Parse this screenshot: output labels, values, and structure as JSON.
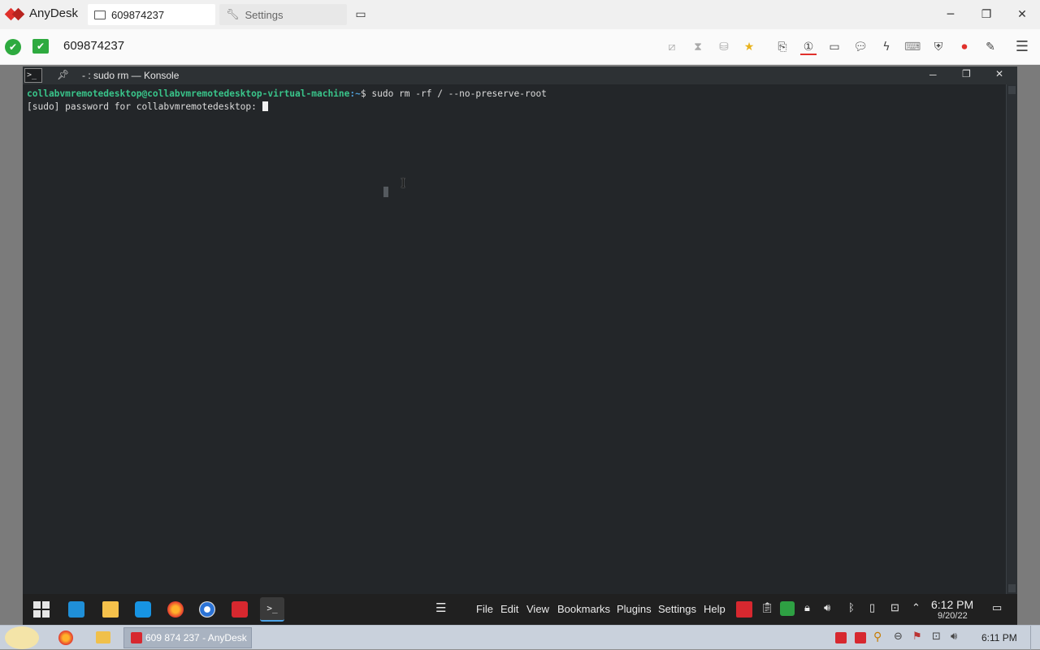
{
  "anydesk": {
    "brand": "AnyDesk",
    "tabs": [
      {
        "label": "609874237"
      },
      {
        "label": "Settings"
      }
    ],
    "address": "609874237",
    "brand_color": "#e0312c"
  },
  "konsole": {
    "title": "- : sudo rm — Konsole",
    "prompt_user_host": "collabvmremotedesktop@collabvmremotedesktop-virtual-machine",
    "prompt_path": ":~",
    "prompt_symbol": "$",
    "command": " sudo rm -rf / --no-preserve-root",
    "sudo_prompt": "[sudo] password for collabvmremotedesktop: "
  },
  "remote_taskbar": {
    "menu": [
      "File",
      "Edit",
      "View",
      "Bookmarks",
      "Plugins",
      "Settings",
      "Help"
    ],
    "time": "6:12 PM",
    "date": "9/20/22"
  },
  "local_taskbar": {
    "task_label": "609 874 237 - AnyDesk",
    "time": "6:11 PM"
  }
}
